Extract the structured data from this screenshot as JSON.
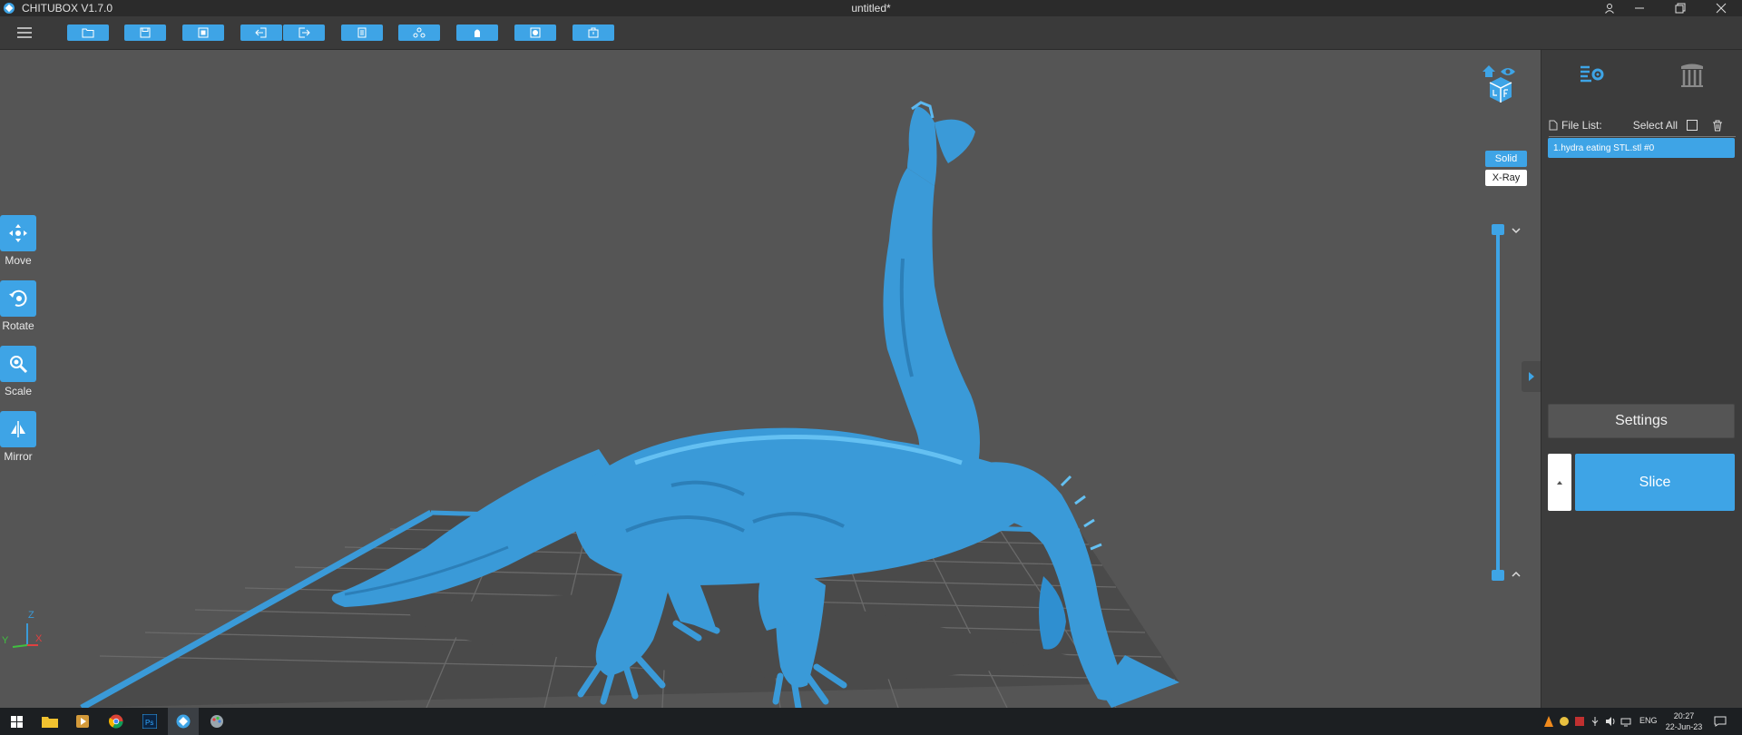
{
  "window": {
    "app_title": "CHITUBOX V1.7.0",
    "document_title": "untitled*",
    "controls": [
      "user-icon",
      "minimize-icon",
      "restore-icon",
      "close-icon"
    ]
  },
  "toolbar": {
    "buttons": [
      "open-file-icon",
      "save-icon",
      "auto-layout-icon",
      "import-icon",
      "export-icon",
      "copy-icon",
      "support-icon",
      "hollow-icon",
      "drill-hole-icon",
      "package-icon"
    ]
  },
  "left_tools": {
    "move": "Move",
    "rotate": "Rotate",
    "scale": "Scale",
    "mirror": "Mirror"
  },
  "view": {
    "solid": "Solid",
    "xray": "X-Ray",
    "axis_z": "Z",
    "axis_y": "Y",
    "axis_x": "X"
  },
  "panel": {
    "tabs": [
      "slice-settings-icon",
      "supports-icon"
    ],
    "file_list_label": "File List:",
    "select_all_label": "Select All",
    "files": [
      "1.hydra eating STL.stl #0"
    ],
    "settings_label": "Settings",
    "slice_label": "Slice"
  },
  "taskbar": {
    "lang": "ENG",
    "time": "20:27",
    "date": "22-Jun-23"
  },
  "colors": {
    "accent": "#3ea4e6",
    "viewport_bg": "#555555",
    "panel_bg": "#3c3c3c",
    "model": "#3a9ad8"
  }
}
